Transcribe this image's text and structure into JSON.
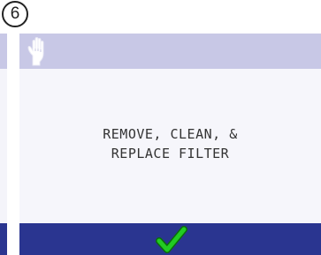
{
  "step": {
    "number": "6"
  },
  "screen": {
    "header_icon": "hand-icon",
    "message_line_1": "REMOVE, CLEAN, &",
    "message_line_2": "REPLACE FILTER",
    "confirm_icon": "checkmark-icon"
  },
  "colors": {
    "header_bg": "#c8c8e6",
    "body_bg": "#f6f6fb",
    "footer_bg": "#2a3590",
    "check_green": "#22cc22"
  }
}
